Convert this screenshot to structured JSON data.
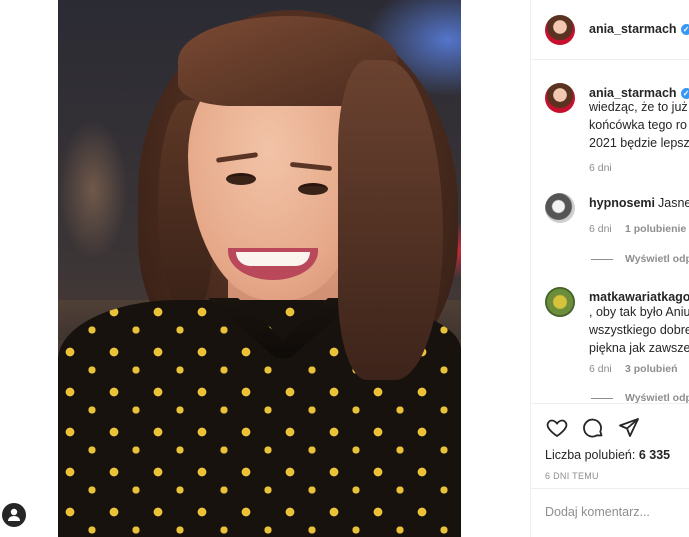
{
  "post": {
    "author": "ania_starmach",
    "verified": true,
    "image_alt": "Selfie photo of smiling woman with wavy brown hair in floral black-and-yellow shirt"
  },
  "comments": [
    {
      "username": "ania_starmach",
      "verified": true,
      "lines": [
        "wiedząc, że to już",
        "końcówka tego ro",
        "2021 będzie lepsz"
      ],
      "time": "6 dni",
      "likes": ""
    },
    {
      "username": "hypnosemi",
      "verified": false,
      "lines": [
        "Jasne,"
      ],
      "time": "6 dni",
      "likes": "1 polubienie",
      "replies": "Wyświetl odp"
    },
    {
      "username": "matkawariatkago",
      "verified": false,
      "lines": [
        ", oby tak było Aniu",
        "wszystkiego dobre",
        "piękna jak zawsze"
      ],
      "time": "6 dni",
      "likes": "3 polubień",
      "replies": "Wyświetl odp"
    }
  ],
  "actions": {
    "like_icon": "heart-icon",
    "comment_icon": "comment-icon",
    "share_icon": "share-icon"
  },
  "likes_label": "Liczba polubień:",
  "likes_count": "6 335",
  "date": "6 DNI TEMU",
  "add_comment_placeholder": "Dodaj komentarz...",
  "colors": {
    "verified": "#3897f0",
    "text": "#262626",
    "muted": "#8e8e8e",
    "divider": "#efefef"
  }
}
